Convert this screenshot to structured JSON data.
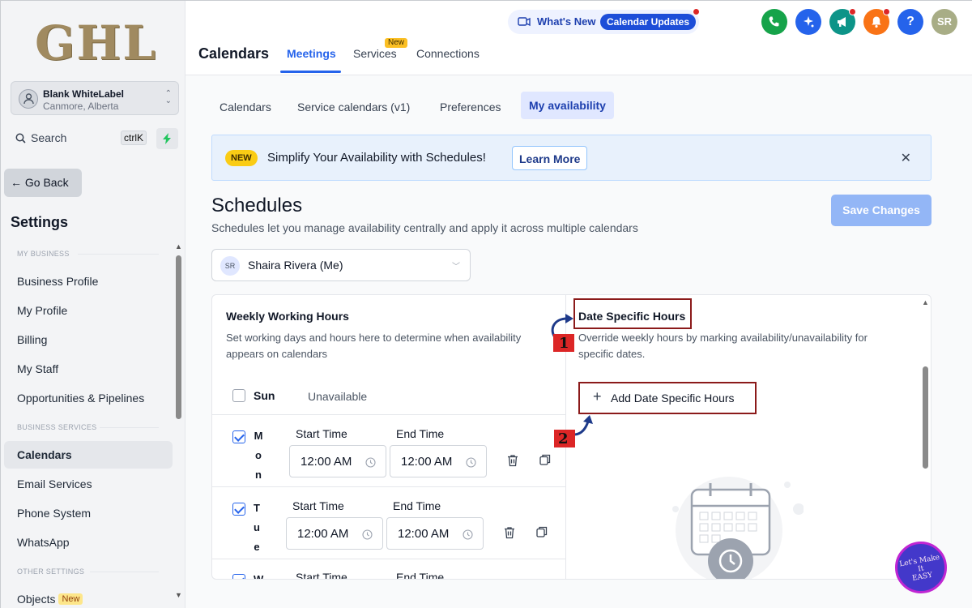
{
  "sidebar": {
    "logo": "GHL",
    "account": {
      "name": "Blank WhiteLabel",
      "location": "Canmore, Alberta"
    },
    "search": {
      "label": "Search",
      "shortcut": "ctrlK"
    },
    "go_back": "Go Back",
    "settings_title": "Settings",
    "sections": {
      "my_business": "MY BUSINESS",
      "business_services": "BUSINESS SERVICES",
      "other_settings": "OTHER SETTINGS"
    },
    "items": [
      {
        "label": "Business Profile"
      },
      {
        "label": "My Profile"
      },
      {
        "label": "Billing"
      },
      {
        "label": "My Staff"
      },
      {
        "label": "Opportunities & Pipelines"
      },
      {
        "label": "Calendars"
      },
      {
        "label": "Email Services"
      },
      {
        "label": "Phone System"
      },
      {
        "label": "WhatsApp"
      },
      {
        "label": "Objects"
      }
    ],
    "objects_badge": "New"
  },
  "header": {
    "whats_new": "What's New",
    "calendar_updates": "Calendar Updates",
    "title": "Calendars",
    "tabs": [
      {
        "label": "Meetings"
      },
      {
        "label": "Services"
      },
      {
        "label": "Connections"
      }
    ],
    "services_badge": "New",
    "avatar_initials": "SR",
    "help_icon_text": "?",
    "colors": {
      "phone": "#16a34a",
      "ai": "#2563eb",
      "megaphone": "#0d9488",
      "bell": "#f97316",
      "help": "#2563eb",
      "avatar": "#a8ad86"
    }
  },
  "subtabs": [
    {
      "label": "Calendars"
    },
    {
      "label": "Service calendars (v1)"
    },
    {
      "label": "Preferences"
    },
    {
      "label": "My availability"
    }
  ],
  "banner": {
    "badge": "NEW",
    "text": "Simplify Your Availability with Schedules!",
    "learn_more": "Learn More",
    "close": "✕"
  },
  "schedules": {
    "title": "Schedules",
    "subtitle": "Schedules let you manage availability centrally and apply it across multiple calendars",
    "save_button": "Save Changes",
    "user": {
      "initials": "SR",
      "name": "Shaira Rivera (Me)"
    }
  },
  "weekly": {
    "title": "Weekly Working Hours",
    "description": "Set working days and hours here to determine when availability appears on calendars",
    "start_label": "Start Time",
    "end_label": "End Time",
    "days": [
      {
        "name": "Sun",
        "checked": false,
        "status": "Unavailable"
      },
      {
        "letters": [
          "M",
          "o",
          "n"
        ],
        "checked": true,
        "start": "12:00 AM",
        "end": "12:00 AM"
      },
      {
        "letters": [
          "T",
          "u",
          "e"
        ],
        "checked": true,
        "start": "12:00 AM",
        "end": "12:00 AM"
      },
      {
        "letters": [
          "W"
        ],
        "checked": true
      }
    ]
  },
  "date_specific": {
    "title": "Date Specific Hours",
    "description": "Override weekly hours by marking availability/unavailability for specific dates.",
    "add_button": "Add Date Specific Hours",
    "annotations": [
      "1",
      "2"
    ]
  },
  "overlay_badge": {
    "line1": "Let's Make",
    "line2": "It",
    "line3": "EASY"
  }
}
